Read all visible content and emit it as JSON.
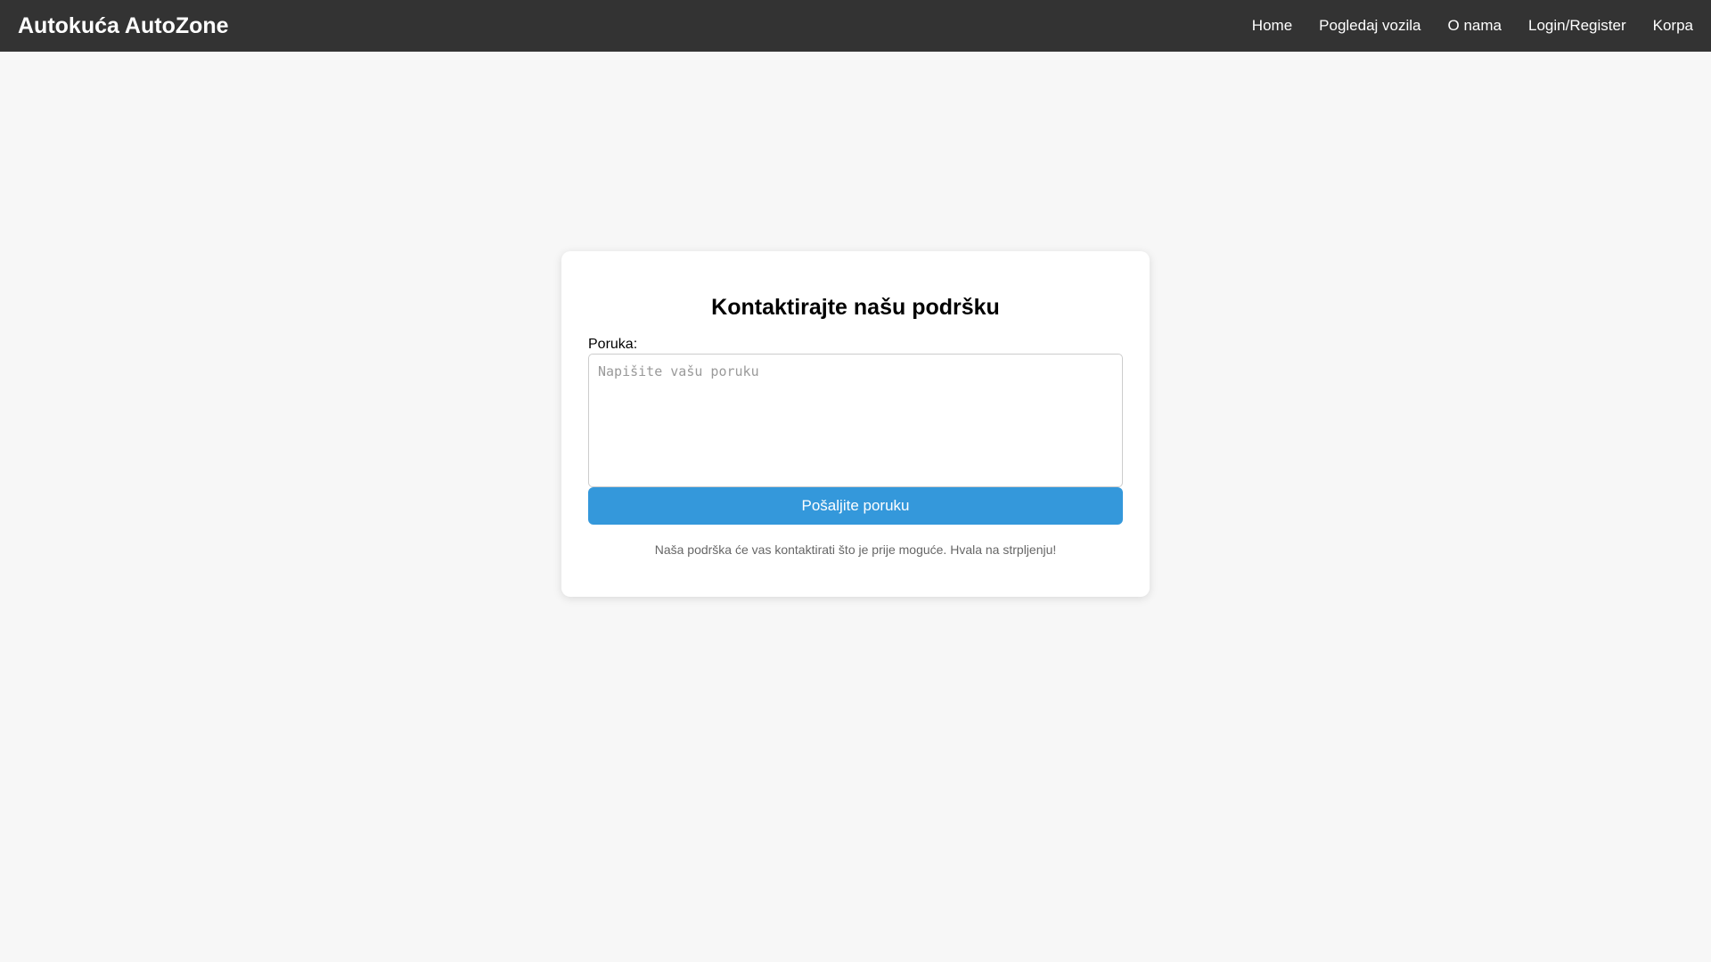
{
  "header": {
    "brand": "Autokuća AutoZone",
    "nav": [
      {
        "label": "Home"
      },
      {
        "label": "Pogledaj vozila"
      },
      {
        "label": "O nama"
      },
      {
        "label": "Login/Register"
      },
      {
        "label": "Korpa"
      }
    ]
  },
  "contact": {
    "title": "Kontaktirajte našu podršku",
    "message_label": "Poruka:",
    "message_placeholder": "Napišite vašu poruku",
    "message_value": "",
    "submit_label": "Pošaljite poruku",
    "note": "Naša podrška će vas kontaktirati što je prije moguće. Hvala na strpljenju!"
  },
  "colors": {
    "header_bg": "#333333",
    "page_bg": "#f7f7f7",
    "accent": "#3498db"
  }
}
